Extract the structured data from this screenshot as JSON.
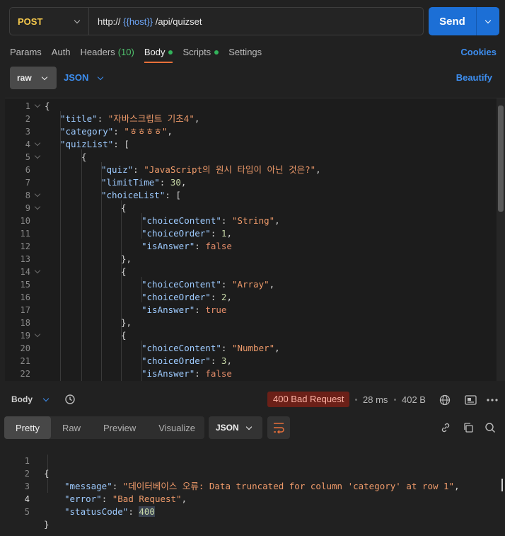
{
  "request": {
    "method": "POST",
    "url_prefix": "http:// ",
    "url_var": "{{host}}",
    "url_suffix": " /api/quizset",
    "send_label": "Send"
  },
  "tabs": {
    "params": "Params",
    "auth": "Auth",
    "headers": "Headers",
    "headers_count": "(10)",
    "body": "Body",
    "scripts": "Scripts",
    "settings": "Settings",
    "cookies": "Cookies"
  },
  "body_type": {
    "raw": "raw",
    "format": "JSON",
    "beautify": "Beautify"
  },
  "editor": {
    "lines": [
      {
        "n": "1",
        "fold": true
      },
      {
        "n": "2"
      },
      {
        "n": "3"
      },
      {
        "n": "4",
        "fold": true
      },
      {
        "n": "5",
        "fold": true
      },
      {
        "n": "6"
      },
      {
        "n": "7"
      },
      {
        "n": "8",
        "fold": true
      },
      {
        "n": "9",
        "fold": true
      },
      {
        "n": "10"
      },
      {
        "n": "11"
      },
      {
        "n": "12"
      },
      {
        "n": "13"
      },
      {
        "n": "14",
        "fold": true
      },
      {
        "n": "15"
      },
      {
        "n": "16"
      },
      {
        "n": "17"
      },
      {
        "n": "18"
      },
      {
        "n": "19",
        "fold": true
      },
      {
        "n": "20"
      },
      {
        "n": "21"
      },
      {
        "n": "22"
      }
    ],
    "code": {
      "l1": "{",
      "l2_key": "\"title\"",
      "l2_val": "\"자바스크립트 기초4\"",
      "l3_key": "\"category\"",
      "l3_val": "\"ㅎㅎㅎㅎ\"",
      "l4_key": "\"quizList\"",
      "l4_rest": ": [",
      "l5": "{",
      "l6_key": "\"quiz\"",
      "l6_val": "\"JavaScript의 원시 타입이 아닌 것은?\"",
      "l7_key": "\"limitTime\"",
      "l7_val": "30",
      "l8_key": "\"choiceList\"",
      "l8_rest": ": [",
      "l9": "{",
      "l10_key": "\"choiceContent\"",
      "l10_val": "\"String\"",
      "l11_key": "\"choiceOrder\"",
      "l11_val": "1",
      "l12_key": "\"isAnswer\"",
      "l12_val": "false",
      "l13": "},",
      "l14": "{",
      "l15_key": "\"choiceContent\"",
      "l15_val": "\"Array\"",
      "l16_key": "\"choiceOrder\"",
      "l16_val": "2",
      "l17_key": "\"isAnswer\"",
      "l17_val": "true",
      "l18": "},",
      "l19": "{",
      "l20_key": "\"choiceContent\"",
      "l20_val": "\"Number\"",
      "l21_key": "\"choiceOrder\"",
      "l21_val": "3",
      "l22_key": "\"isAnswer\"",
      "l22_val": "false"
    }
  },
  "response": {
    "body_label": "Body",
    "status": "400 Bad Request",
    "time": "28 ms",
    "size": "402 B",
    "tabs": [
      "Pretty",
      "Raw",
      "Preview",
      "Visualize"
    ],
    "format": "JSON",
    "lines": [
      "1",
      "2",
      "3",
      "4",
      "5"
    ],
    "code": {
      "open": "{",
      "message_key": "\"message\"",
      "message_val": "\"데이터베이스 오류: Data truncated for column 'category' at row 1\"",
      "error_key": "\"error\"",
      "error_val": "\"Bad Request\"",
      "status_key": "\"statusCode\"",
      "status_val": "400",
      "close": "}"
    }
  },
  "colors": {
    "accent": "#1c6fd6",
    "method": "#f5c84c",
    "status_bg": "#6b2018",
    "tab_underline": "#e8703a"
  }
}
